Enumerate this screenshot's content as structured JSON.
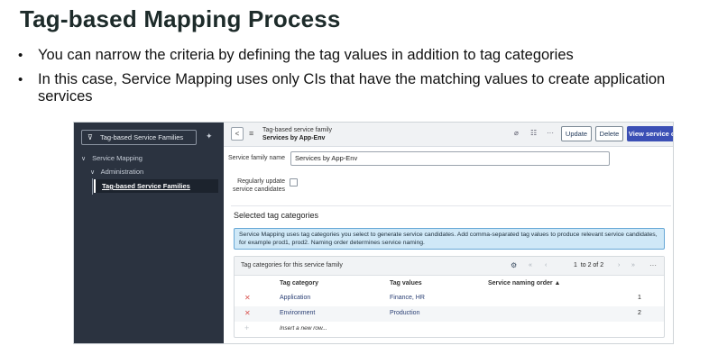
{
  "slide": {
    "title": "Tag-based Mapping Process",
    "bullets": [
      "You can narrow the criteria by defining the tag values in addition to tag categories",
      "In this case, Service Mapping uses only CIs that have the matching values to create application services"
    ]
  },
  "sidebar": {
    "filter": "Tag-based Service Families",
    "items": [
      {
        "label": "Service Mapping",
        "icon": "chevron-down"
      },
      {
        "label": "Administration",
        "icon": "chevron-down"
      },
      {
        "label": "Tag-based Service Families"
      }
    ]
  },
  "header": {
    "title_line1": "Tag-based service family",
    "title_line2": "Services by App-Env",
    "update_label": "Update",
    "delete_label": "Delete",
    "view_label": "View service candidates"
  },
  "form": {
    "family_name_label": "Service family name",
    "family_name_value": "Services by App-Env",
    "regular_update_label": "Regularly update service candidates"
  },
  "section": {
    "title": "Selected tag categories",
    "info": "Service Mapping uses tag categories you select to generate service candidates. Add comma-separated tag values to produce relevant service candidates, for example prod1, prod2. Naming order determines service naming."
  },
  "related_list": {
    "title": "Tag categories for this service family",
    "page_current": "1",
    "page_range": "to 2 of 2",
    "columns": [
      "Tag category",
      "Tag values",
      "Service naming order ▲"
    ],
    "rows": [
      {
        "category": "Application",
        "values": "Finance, HR",
        "order": "1"
      },
      {
        "category": "Environment",
        "values": "Production",
        "order": "2"
      }
    ],
    "insert_label": "Insert a new row..."
  },
  "colors": {
    "sidebar_bg": "#2b3340",
    "primary_button": "#3b4fb5",
    "info_bg": "#cfe8f7",
    "link": "#2a3f74"
  }
}
